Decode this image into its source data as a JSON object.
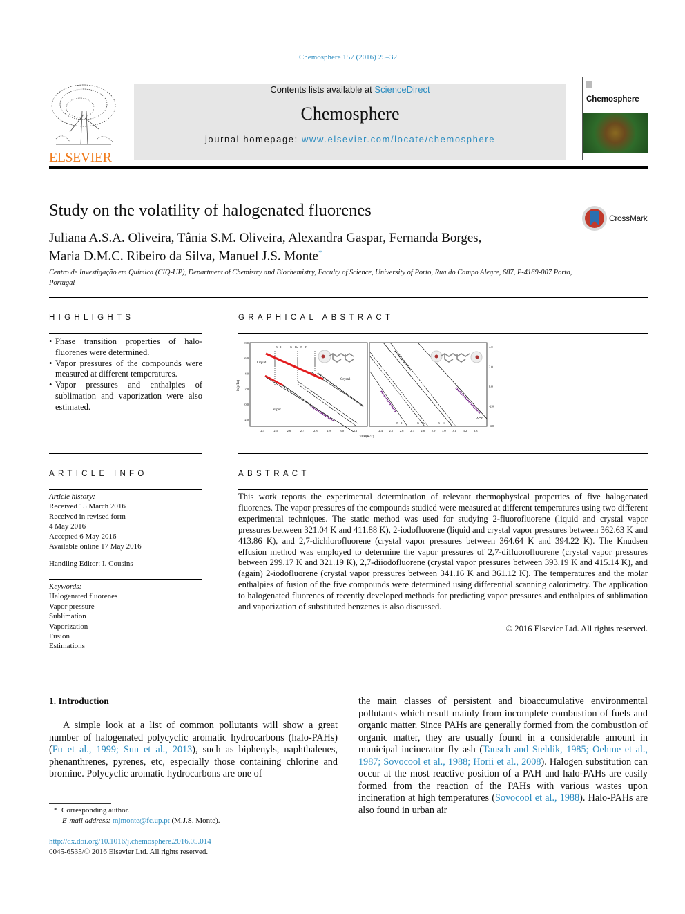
{
  "journal_ref": "Chemosphere 157 (2016) 25–32",
  "header": {
    "contents_prefix": "Contents lists available at ",
    "sciencedirect": "ScienceDirect",
    "journal_title": "Chemosphere",
    "homepage_prefix": "journal homepage: ",
    "homepage_url": "www.elsevier.com/locate/chemosphere",
    "publisher_logo": "ELSEVIER",
    "cover_title": "Chemosphere"
  },
  "article": {
    "title": "Study on the volatility of halogenated fluorenes",
    "authors_line1": "Juliana A.S.A. Oliveira, Tânia S.M. Oliveira, Alexandra Gaspar, Fernanda Borges,",
    "authors_line2": "Maria D.M.C. Ribeiro da Silva, Manuel J.S. Monte",
    "corresponding_mark": "*",
    "affiliation": "Centro de Investigação em Química (CIQ-UP), Department of Chemistry and Biochemistry, Faculty of Science, University of Porto, Rua do Campo Alegre, 687, P-4169-007 Porto, Portugal",
    "crossmark": "CrossMark"
  },
  "highlights": {
    "heading": "HIGHLIGHTS",
    "items": [
      "Phase transition properties of halo-fluorenes were determined.",
      "Vapor pressures of the compounds were measured at different temperatures.",
      "Vapor pressures and enthalpies of sublimation and vaporization were also estimated."
    ]
  },
  "graphical_abstract": {
    "heading": "GRAPHICAL ABSTRACT",
    "ylabel": "ln(p/Pa)",
    "xlabel": "1000(K/T)",
    "left_yticks": [
      "8.0",
      "6.0",
      "4.0",
      "2.0",
      "0.0",
      "-2.0"
    ],
    "left_xticks": [
      "2.4",
      "2.5",
      "2.6",
      "2.7",
      "2.8",
      "2.9",
      "3.0",
      "3.1"
    ],
    "right_yticks": [
      "4.0",
      "2.0",
      "0.0",
      "-2.0",
      "-4.0"
    ],
    "right_xticks": [
      "2.4",
      "2.5",
      "2.6",
      "2.7",
      "2.8",
      "2.9",
      "3.0",
      "3.1",
      "3.2",
      "3.3"
    ],
    "left_labels": {
      "liquid": "Liquid",
      "crystal": "Crystal",
      "vapor": "Vapor",
      "x1": "X = I",
      "x2": "X = Br",
      "x3": "X = F"
    },
    "right_labels": {
      "x1": "X = I",
      "x2": "X = Br",
      "x3": "X = Cl",
      "x4": "X = F"
    }
  },
  "article_info": {
    "heading": "ARTICLE INFO",
    "history_label": "Article history:",
    "history": [
      "Received 15 March 2016",
      "Received in revised form",
      "4 May 2016",
      "Accepted 6 May 2016",
      "Available online 17 May 2016"
    ],
    "handling_editor": "Handling Editor: I. Cousins",
    "keywords_label": "Keywords:",
    "keywords": [
      "Halogenated fluorenes",
      "Vapor pressure",
      "Sublimation",
      "Vaporization",
      "Fusion",
      "Estimations"
    ]
  },
  "abstract": {
    "heading": "ABSTRACT",
    "text": "This work reports the experimental determination of relevant thermophysical properties of five halogenated fluorenes. The vapor pressures of the compounds studied were measured at different temperatures using two different experimental techniques. The static method was used for studying 2-fluorofluorene (liquid and crystal vapor pressures between 321.04 K and 411.88 K), 2-iodofluorene (liquid and crystal vapor pressures between 362.63 K and 413.86 K), and 2,7-dichlorofluorene (crystal vapor pressures between 364.64 K and 394.22 K). The Knudsen effusion method was employed to determine the vapor pressures of 2,7-difluorofluorene (crystal vapor pressures between 299.17 K and 321.19 K), 2,7-diiodofluorene (crystal vapor pressures between 393.19 K and 415.14 K), and (again) 2-iodofluorene (crystal vapor pressures between 341.16 K and 361.12 K). The temperatures and the molar enthalpies of fusion of the five compounds were determined using differential scanning calorimetry. The application to halogenated fluorenes of recently developed methods for predicting vapor pressures and enthalpies of sublimation and vaporization of substituted benzenes is also discussed.",
    "copyright": "© 2016 Elsevier Ltd. All rights reserved."
  },
  "intro": {
    "heading": "1.  Introduction",
    "p1_a": "A simple look at a list of common pollutants will show a great number of halogenated polycyclic aromatic hydrocarbons (halo-PAHs) (",
    "p1_ref": "Fu et al., 1999; Sun et al., 2013",
    "p1_b": "), such as biphenyls, naphthalenes, phenanthrenes, pyrenes, etc, especially those containing chlorine and bromine. Polycyclic aromatic hydrocarbons are one of",
    "p2_a": "the main classes of persistent and bioaccumulative environmental pollutants which result mainly from incomplete combustion of fuels and organic matter. Since PAHs are generally formed from the combustion of organic matter, they are usually found in a considerable amount in municipal incinerator fly ash (",
    "p2_ref1": "Tausch and Stehlik, 1985; Oehme et al., 1987; Sovocool et al., 1988; Horii et al., 2008",
    "p2_b": "). Halogen substitution can occur at the most reactive position of a PAH and halo-PAHs are easily formed from the reaction of the PAHs with various wastes upon incineration at high temperatures (",
    "p2_ref2": "Sovocool et al., 1988",
    "p2_c": "). Halo-PAHs are also found in urban air"
  },
  "footnote": {
    "mark": "*",
    "corresponding": "Corresponding author.",
    "email_label": "E-mail address: ",
    "email": "mjmonte@fc.up.pt",
    "email_suffix": " (M.J.S. Monte)."
  },
  "doi": "http://dx.doi.org/10.1016/j.chemosphere.2016.05.014",
  "issn": "0045-6535/© 2016 Elsevier Ltd. All rights reserved.",
  "colors": {
    "link": "#2a8bbf",
    "elsevier_orange": "#f07a1a",
    "header_grey": "#e6e6e6"
  }
}
